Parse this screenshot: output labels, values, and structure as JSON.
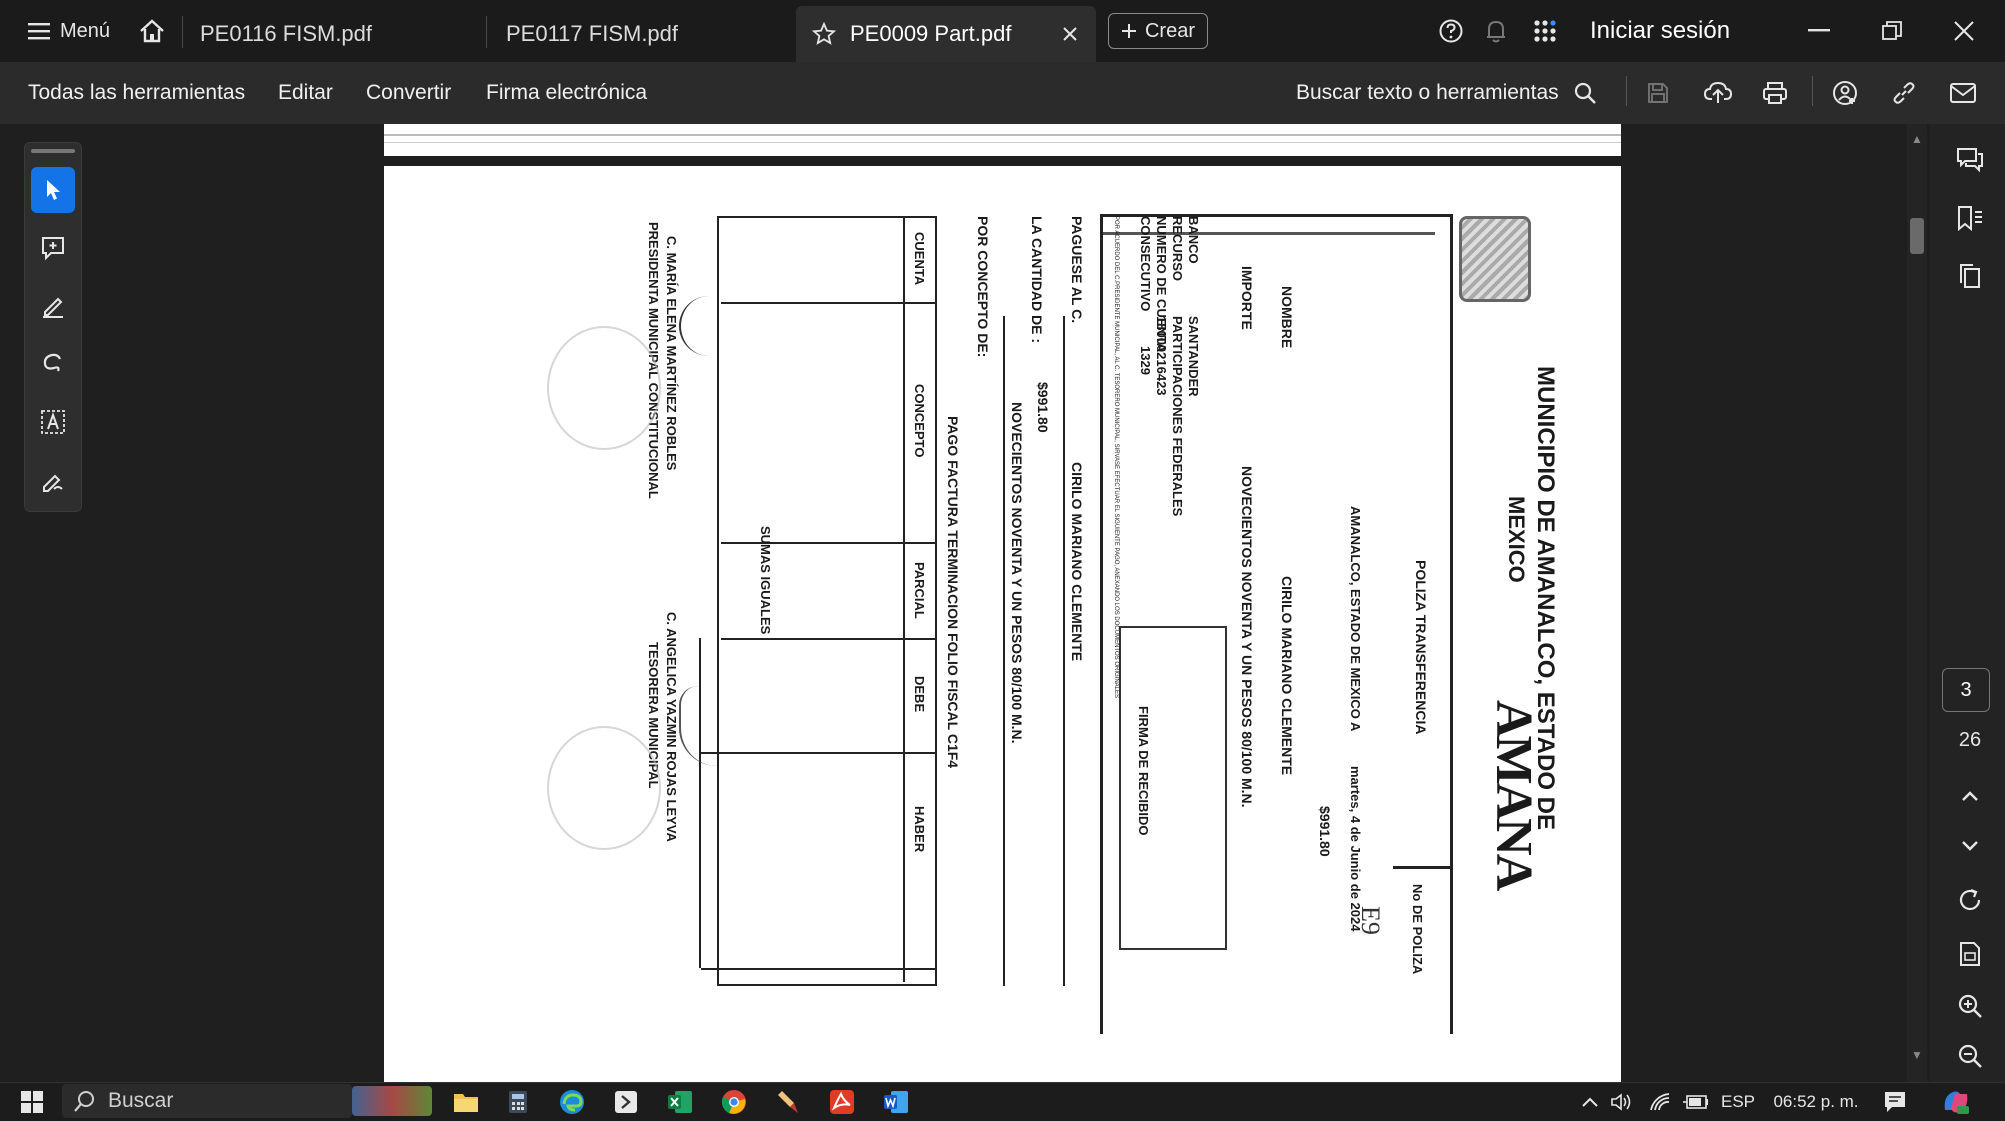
{
  "tabbar": {
    "menu_label": "Menú",
    "tabs": [
      {
        "label": "PE0116 FISM.pdf"
      },
      {
        "label": "PE0117 FISM.pdf"
      },
      {
        "label": "PE0009 Part.pdf",
        "active": true
      }
    ],
    "create_label": "Crear",
    "sign_in_label": "Iniciar sesión"
  },
  "toolbar": {
    "items": [
      "Todas las herramientas",
      "Editar",
      "Convertir",
      "Firma electrónica"
    ],
    "search_label": "Buscar texto o herramientas"
  },
  "page_nav": {
    "current_page": "3",
    "total_pages": "26"
  },
  "document": {
    "municipality_line1": "MUNICIPIO DE AMANALCO, ESTADO DE",
    "municipality_line2": "MEXICO",
    "brand_text": "AMANA",
    "poliza_type": "POLIZA TRANSFERENCIA",
    "poliza_no_label": "No DE POLIZA",
    "poliza_no_value": "E9",
    "place": "AMANALCO, ESTADO DE MEXICO A",
    "date": "martes, 4 de Junio de 2024",
    "nombre_label": "NOMBRE",
    "nombre_value": "CIRILO MARIANO CLEMENTE",
    "importe_label": "IMPORTE",
    "importe_value": "NOVECIENTOS NOVENTA Y UN PESOS 80/100 M.N.",
    "importe_amount": "$991.80",
    "banco_label": "BANCO",
    "banco_value": "SANTANDER",
    "recurso_label": "RECURSO",
    "recurso_value": "PARTICIPACIONES FEDERALES",
    "cuenta_label": "NUMERO DE CUENTA",
    "cuenta_value": "18000216423",
    "consecutivo_label": "CONSECUTIVO",
    "consecutivo_value": "1329",
    "firma_recibido": "FIRMA DE RECIBIDO",
    "acuerdo_text": "POR ACUERDO DEL C.PRESIDENTE MUNICIPAL, AL C. TESORERO MUNICIPAL, SIRVASE EFECTUAR EL SIGUIENTE PAGO, ANEXANDO LOS DOCUMENTOS ORIGINALES",
    "paguese_label": "PAGUESE AL C.",
    "paguese_value": "CIRILO MARIANO CLEMENTE",
    "cantidad_label": "LA CANTIDAD DE :",
    "cantidad_amount": "$991.80",
    "cantidad_words": "NOVECIENTOS NOVENTA Y UN PESOS 80/100 M.N.",
    "concepto_label": "POR CONCEPTO DE:",
    "concepto_value": "PAGO FACTURA TERMINACION FOLIO FISCAL C1F4",
    "table_headers": [
      "CUENTA",
      "CONCEPTO",
      "PARCIAL",
      "DEBE",
      "HABER"
    ],
    "sumas_iguales": "SUMAS IGUALES",
    "signer1_name": "C. MARÍA ELENA MARTÍNEZ ROBLES",
    "signer1_title": "PRESIDENTA MUNICIPAL CONSTITUCIONAL",
    "signer2_name": "C. ANGELICA YAZMIN ROJAS LEYVA",
    "signer2_title": "TESORERA MUNICIPAL"
  },
  "taskbar": {
    "search_label": "Buscar",
    "language": "ESP",
    "time": "06:52 p. m."
  },
  "colors": {
    "accent": "#1473e6",
    "background": "#1e1e1e"
  }
}
